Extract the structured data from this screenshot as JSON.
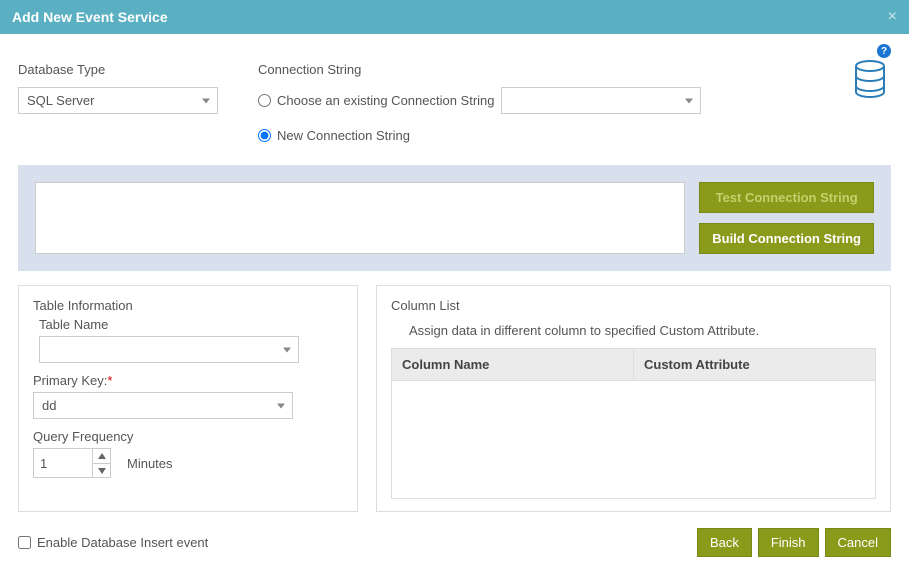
{
  "titlebar": {
    "title": "Add New Event Service",
    "close": "×"
  },
  "help": "?",
  "dbtype": {
    "label": "Database Type",
    "value": "SQL Server"
  },
  "connstr": {
    "label": "Connection String",
    "radio_existing": "Choose an existing Connection String",
    "radio_new": "New Connection String",
    "existing_value": "",
    "textarea_value": "",
    "btn_test": "Test Connection String",
    "btn_build": "Build Connection String"
  },
  "tableinfo": {
    "title": "Table Information",
    "table_name_label": "Table Name",
    "table_name_value": "",
    "pk_label": "Primary Key:",
    "pk_value": "dd",
    "qf_label": "Query Frequency",
    "qf_value": "1",
    "qf_unit": "Minutes"
  },
  "columnlist": {
    "title": "Column List",
    "desc": "Assign data in different column to specified Custom Attribute.",
    "h1": "Column Name",
    "h2": "Custom Attribute"
  },
  "enable_insert": "Enable Database Insert event",
  "footer": {
    "back": "Back",
    "finish": "Finish",
    "cancel": "Cancel"
  }
}
